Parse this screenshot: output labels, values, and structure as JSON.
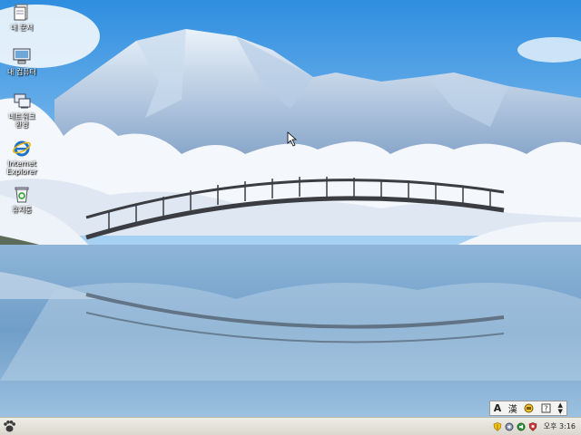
{
  "desktop": {
    "icons": [
      {
        "label": "내 문서",
        "icon": "my-documents-icon"
      },
      {
        "label": "내 컴퓨터",
        "icon": "my-computer-icon"
      },
      {
        "label": "네트워크\n환경",
        "icon": "network-places-icon"
      },
      {
        "label": "Internet\nExplorer",
        "icon": "internet-explorer-icon"
      },
      {
        "label": "휴지통",
        "icon": "recycle-bin-icon"
      }
    ]
  },
  "ime": {
    "mode_label": "A",
    "hanja_label": "漢"
  },
  "taskbar": {
    "start_icon": "start-paw-icon",
    "clock": "오후 3:16",
    "tray_icons": [
      "security-shield-icon",
      "network-icon",
      "volume-icon",
      "antivirus-icon"
    ]
  },
  "colors": {
    "taskbar": "#e4e2d8",
    "sky": "#4c9be0"
  }
}
